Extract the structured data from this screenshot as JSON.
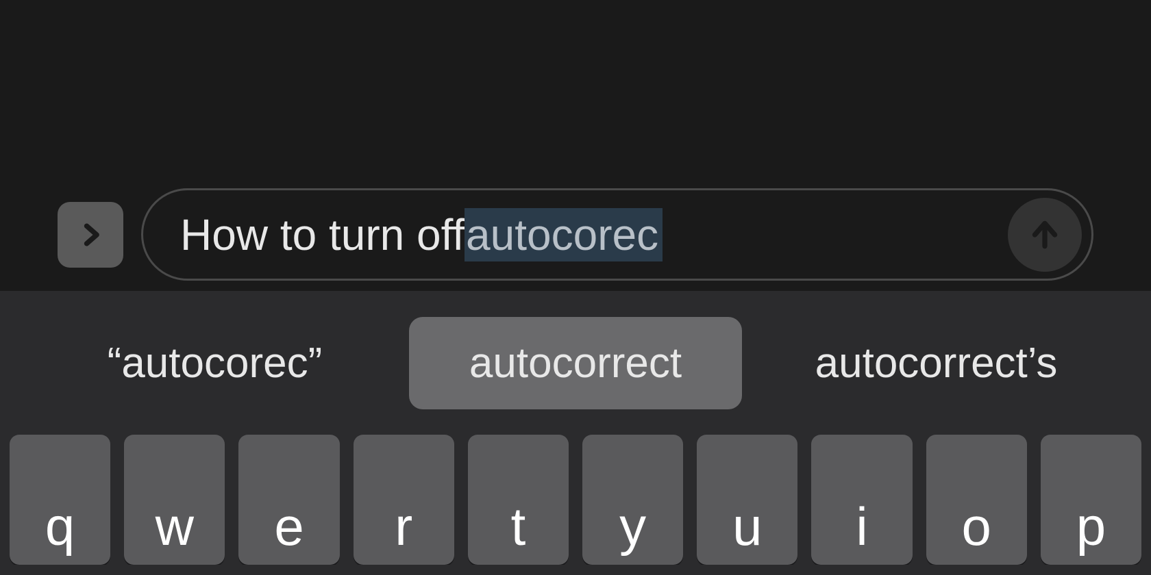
{
  "input": {
    "typed_text": "How to turn off ",
    "highlighted_text": "autocorec"
  },
  "suggestions": {
    "left": "“autocorec”",
    "center": "autocorrect",
    "right": "autocorrect’s"
  },
  "keyboard": {
    "row1": [
      "q",
      "w",
      "e",
      "r",
      "t",
      "y",
      "u",
      "i",
      "o",
      "p"
    ]
  }
}
